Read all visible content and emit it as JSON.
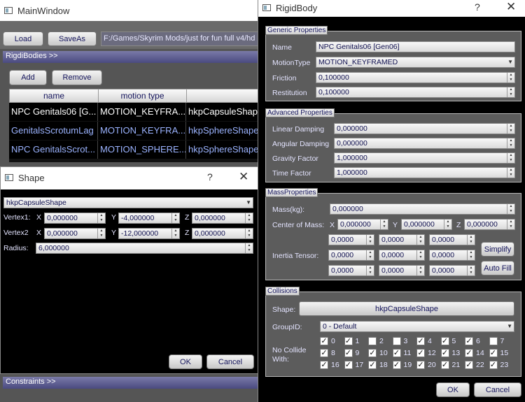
{
  "main_window": {
    "title": "MainWindow",
    "load_label": "Load",
    "saveas_label": "SaveAs",
    "path_value": "F:/Games/Skyrim Mods/just for fun full v4/hd",
    "rigidbodies_label": "RigdiBodies >>",
    "add_label": "Add",
    "remove_label": "Remove",
    "table": {
      "headers": [
        "name",
        "motion type",
        ""
      ],
      "rows": [
        [
          "NPC Genitals06 [G...",
          "MOTION_KEYFRA...",
          "hkpCapsuleShape"
        ],
        [
          "GenitalsScrotumLag",
          "MOTION_KEYFRA...",
          "hkpSphereShape"
        ],
        [
          "NPC GenitalsScrot...",
          "MOTION_SPHERE...",
          "hkpSphereShape"
        ]
      ]
    },
    "constraints_label": "Constraints >>"
  },
  "shape_dialog": {
    "title": "Shape",
    "help": "?",
    "close": "✕",
    "shape_type": "hkpCapsuleShape",
    "vertex1_label": "Vertex1:",
    "vertex2_label": "Vertex2",
    "radius_label": "Radius:",
    "x_label": "X",
    "y_label": "Y",
    "z_label": "Z",
    "v1": {
      "x": "0,000000",
      "y": "-4,000000",
      "z": "0,000000"
    },
    "v2": {
      "x": "0,000000",
      "y": "-12,000000",
      "z": "0,000000"
    },
    "radius": "6,000000",
    "ok_label": "OK",
    "cancel_label": "Cancel"
  },
  "rigidbody_dialog": {
    "title": "RigidBody",
    "help": "?",
    "close": "✕",
    "generic": {
      "title": "Generic Properties",
      "name_label": "Name",
      "name_value": "NPC Genitals06 [Gen06]",
      "motiontype_label": "MotionType",
      "motiontype_value": "MOTION_KEYFRAMED",
      "friction_label": "Friction",
      "friction_value": "0,100000",
      "restitution_label": "Restitution",
      "restitution_value": "0,100000"
    },
    "advanced": {
      "title": "Advanced Properties",
      "linear_label": "Linear Damping",
      "linear_value": "0,000000",
      "angular_label": "Angular Damping",
      "angular_value": "0,000000",
      "gravity_label": "Gravity Factor",
      "gravity_value": "1,000000",
      "time_label": "Time Factor",
      "time_value": "1,000000"
    },
    "mass": {
      "title": "MassProperties",
      "mass_label": "Mass(kg):",
      "mass_value": "0,000000",
      "com_label": "Center of Mass:",
      "x_label": "X",
      "y_label": "Y",
      "z_label": "Z",
      "com_x": "0,000000",
      "com_y": "0,000000",
      "com_z": "0,000000",
      "inertia_label": "Inertia Tensor:",
      "inertia": [
        [
          "0,0000",
          "0,0000",
          "0,0000"
        ],
        [
          "0,0000",
          "0,0000",
          "0,0000"
        ],
        [
          "0,0000",
          "0,0000",
          "0,0000"
        ]
      ],
      "simplify_label": "Simplify",
      "autofill_label": "Auto Fill"
    },
    "collisions": {
      "title": "Collisions",
      "shape_label": "Shape:",
      "shape_button": "hkpCapsuleShape",
      "groupid_label": "GroupID:",
      "groupid_value": "0 - Default",
      "nocollide_label1": "No Collide",
      "nocollide_label2": "With:",
      "checks": [
        {
          "n": "0",
          "c": true
        },
        {
          "n": "1",
          "c": true
        },
        {
          "n": "2",
          "c": false
        },
        {
          "n": "3",
          "c": false
        },
        {
          "n": "4",
          "c": true
        },
        {
          "n": "5",
          "c": true
        },
        {
          "n": "6",
          "c": true
        },
        {
          "n": "7",
          "c": false
        },
        {
          "n": "8",
          "c": true
        },
        {
          "n": "9",
          "c": true
        },
        {
          "n": "10",
          "c": true
        },
        {
          "n": "11",
          "c": true
        },
        {
          "n": "12",
          "c": true
        },
        {
          "n": "13",
          "c": true
        },
        {
          "n": "14",
          "c": true
        },
        {
          "n": "15",
          "c": true
        },
        {
          "n": "16",
          "c": true
        },
        {
          "n": "17",
          "c": true
        },
        {
          "n": "18",
          "c": true
        },
        {
          "n": "19",
          "c": true
        },
        {
          "n": "20",
          "c": true
        },
        {
          "n": "21",
          "c": true
        },
        {
          "n": "22",
          "c": true
        },
        {
          "n": "23",
          "c": true
        }
      ]
    },
    "ok_label": "OK",
    "cancel_label": "Cancel"
  }
}
